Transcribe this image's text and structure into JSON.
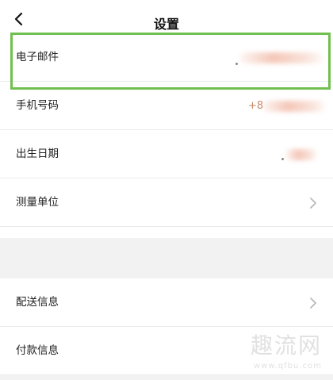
{
  "header": {
    "title": "设置",
    "back_icon": "chevron-left-icon"
  },
  "settings": {
    "email": {
      "label": "电子邮件",
      "value_hidden": true
    },
    "phone": {
      "label": "手机号码",
      "value_prefix": "+8"
    },
    "birthday": {
      "label": "出生日期",
      "value_hidden": true
    },
    "units": {
      "label": "测量单位",
      "icon": "chevron-right-icon"
    }
  },
  "more": {
    "shipping": {
      "label": "配送信息",
      "icon": "chevron-right-icon"
    },
    "payment": {
      "label": "付款信息"
    }
  },
  "watermark": {
    "text": "趣流网",
    "url": "www.qfbu.com"
  },
  "colors": {
    "highlight": "#71c04f",
    "divider": "#ececec",
    "section_gap": "#f2f2f2",
    "masked_value": "#c98a6a"
  }
}
